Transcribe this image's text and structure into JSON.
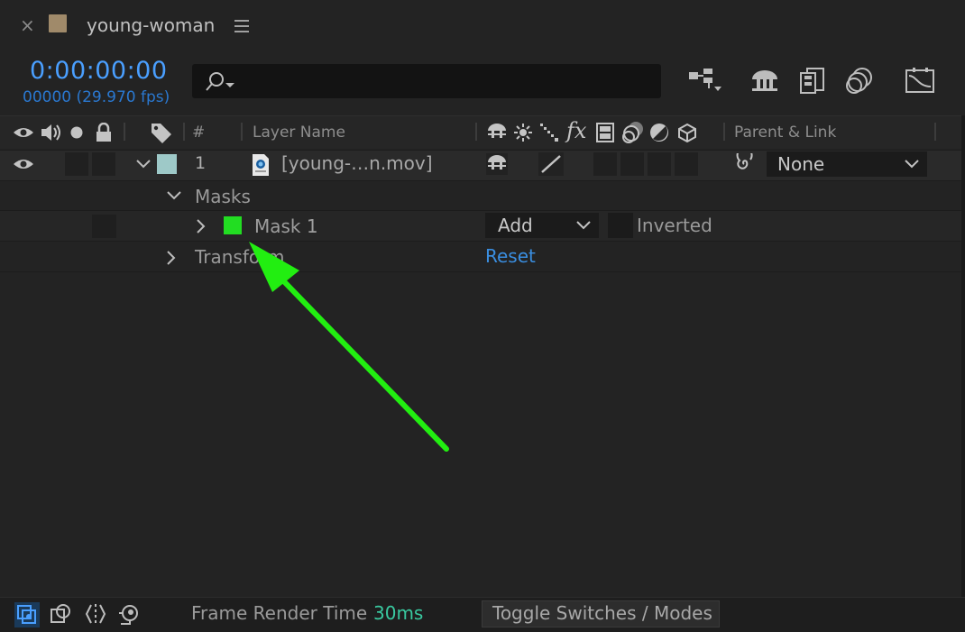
{
  "panel": {
    "close_glyph": "×",
    "comp_name": "young-woman",
    "menu_icon": "hamburger-menu-icon",
    "swatch_color": "#a08a6a"
  },
  "time": {
    "timecode": "0:00:00:00",
    "frame_info": "00000 (29.970 fps)"
  },
  "search": {
    "placeholder": ""
  },
  "toolbar": {
    "icons": [
      "comp-flowchart-icon",
      "draft-3d-icon",
      "frame-blending-icon",
      "motion-blur-icon",
      "graph-editor-icon"
    ]
  },
  "header": {
    "number": "#",
    "layer_name": "Layer Name",
    "parent_link": "Parent & Link"
  },
  "layer": {
    "index": "1",
    "name": "[young-…n.mov]",
    "label_color": "#9ec9c8",
    "parent": "None"
  },
  "masks": {
    "group_label": "Masks",
    "mask_name": "Mask 1",
    "mask_color": "#22dd22",
    "mode": "Add",
    "inverted_label": "Inverted"
  },
  "transform": {
    "label": "Transform",
    "reset_label": "Reset"
  },
  "footer": {
    "frame_render_label": "Frame Render Time",
    "frame_render_value": "30ms",
    "toggle_label": "Toggle Switches / Modes"
  },
  "annotation": {
    "arrow_color": "#22ee11"
  }
}
